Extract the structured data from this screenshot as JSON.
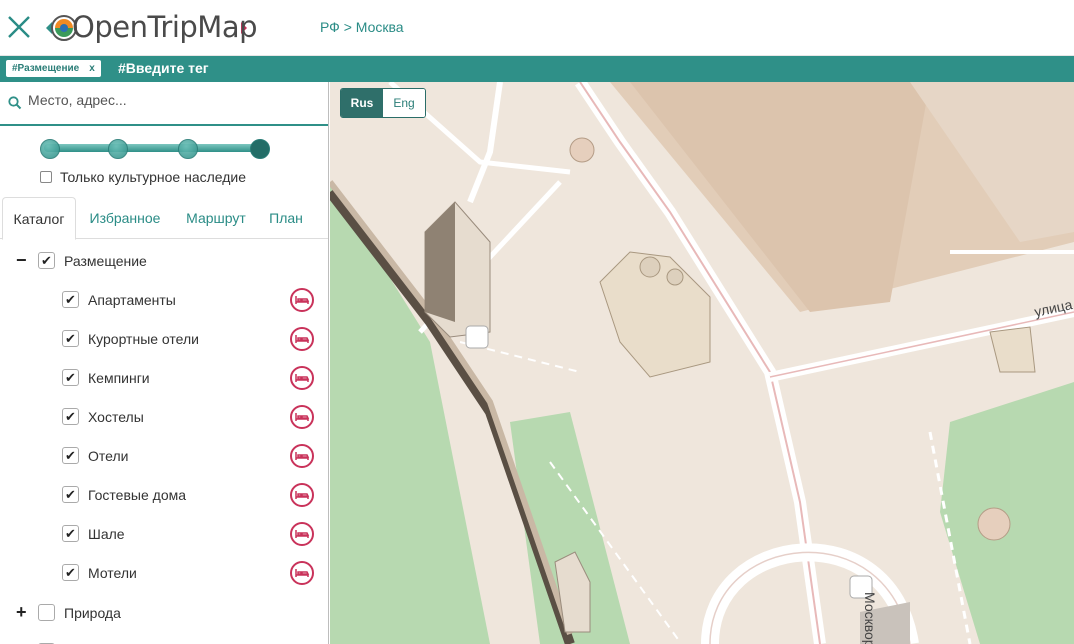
{
  "header": {
    "logo_text": "OpenTripMap",
    "breadcrumb": "РФ > Москва"
  },
  "tagbar": {
    "chip_label": "#Размещение",
    "chip_close": "x",
    "input_placeholder": "#Введите тег"
  },
  "search": {
    "placeholder": "Место, адрес..."
  },
  "slider": {
    "level": 4,
    "steps": 4
  },
  "heritage": {
    "label": "Только культурное наследие",
    "checked": false
  },
  "tabs": [
    {
      "label": "Каталог",
      "active": true
    },
    {
      "label": "Избранное",
      "active": false
    },
    {
      "label": "Маршрут",
      "active": false
    },
    {
      "label": "План",
      "active": false
    }
  ],
  "catalog": {
    "group": {
      "expander": "−",
      "label": "Размещение",
      "checked": true
    },
    "items": [
      {
        "label": "Апартаменты",
        "checked": true
      },
      {
        "label": "Курортные отели",
        "checked": true
      },
      {
        "label": "Кемпинги",
        "checked": true
      },
      {
        "label": "Хостелы",
        "checked": true
      },
      {
        "label": "Отели",
        "checked": true
      },
      {
        "label": "Гостевые дома",
        "checked": true
      },
      {
        "label": "Шале",
        "checked": true
      },
      {
        "label": "Мотели",
        "checked": true
      }
    ],
    "next_group": {
      "expander": "+",
      "label": "Природа",
      "checked": false
    }
  },
  "map": {
    "lang_active": "Rus",
    "lang_other": "Eng",
    "street_1": "улица",
    "street_2": "Москворе"
  },
  "colors": {
    "accent": "#2f9088",
    "accent_dark": "#2f6f6a",
    "category_icon": "#c9325a",
    "map_land": "#efe6dc",
    "map_park": "#b7d9b0",
    "map_road": "#ffffff"
  }
}
